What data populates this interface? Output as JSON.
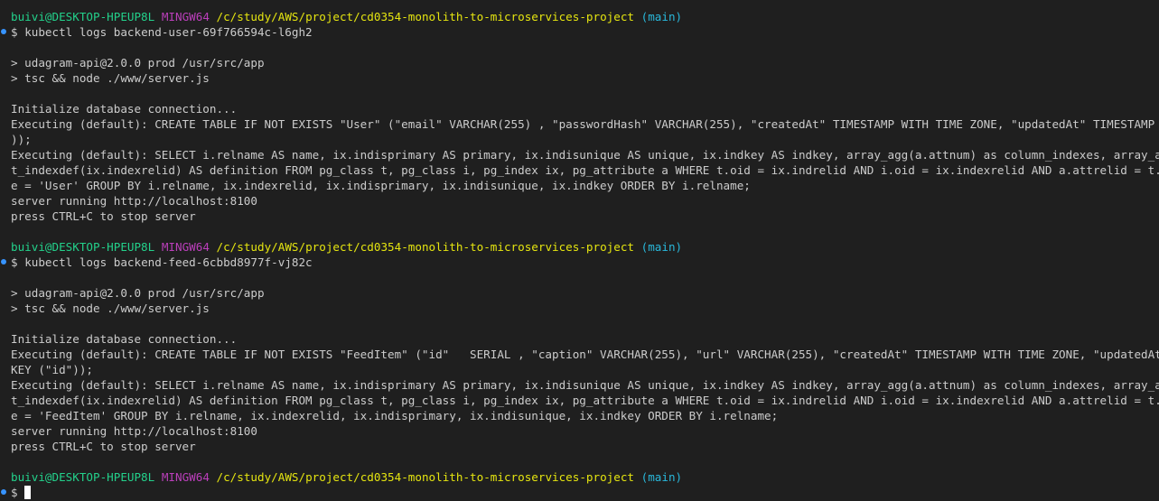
{
  "prompt": {
    "user_host": "buivi@DESKTOP-HPEUP8L",
    "shell": "MINGW64",
    "path": "/c/study/AWS/project/cd0354-monolith-to-microservices-project",
    "branch": "(main)",
    "symbol": "$"
  },
  "block1": {
    "command": "kubectl logs backend-user-69f766594c-l6gh2",
    "out1": "> udagram-api@2.0.0 prod /usr/src/app",
    "out2": "> tsc && node ./www/server.js",
    "out3": "Initialize database connection...",
    "out4": "Executing (default): CREATE TABLE IF NOT EXISTS \"User\" (\"email\" VARCHAR(255) , \"passwordHash\" VARCHAR(255), \"createdAt\" TIMESTAMP WITH TIME ZONE, \"updatedAt\" TIMESTAMP WITH TIME ZONE,",
    "out5": "));",
    "out6": "Executing (default): SELECT i.relname AS name, ix.indisprimary AS primary, ix.indisunique AS unique, ix.indkey AS indkey, array_agg(a.attnum) as column_indexes, array_agg(a.attname) as",
    "out7": "t_indexdef(ix.indexrelid) AS definition FROM pg_class t, pg_class i, pg_index ix, pg_attribute a WHERE t.oid = ix.indrelid AND i.oid = ix.indexrelid AND a.attrelid = t.oid AND t.relkind",
    "out8": "e = 'User' GROUP BY i.relname, ix.indexrelid, ix.indisprimary, ix.indisunique, ix.indkey ORDER BY i.relname;",
    "out9": "server running http://localhost:8100",
    "out10": "press CTRL+C to stop server"
  },
  "block2": {
    "command": "kubectl logs backend-feed-6cbbd8977f-vj82c",
    "out1": "> udagram-api@2.0.0 prod /usr/src/app",
    "out2": "> tsc && node ./www/server.js",
    "out3": "Initialize database connection...",
    "out4": "Executing (default): CREATE TABLE IF NOT EXISTS \"FeedItem\" (\"id\"   SERIAL , \"caption\" VARCHAR(255), \"url\" VARCHAR(255), \"createdAt\" TIMESTAMP WITH TIME ZONE, \"updatedAt\" TIMESTAMP WITH",
    "out5": "KEY (\"id\"));",
    "out6": "Executing (default): SELECT i.relname AS name, ix.indisprimary AS primary, ix.indisunique AS unique, ix.indkey AS indkey, array_agg(a.attnum) as column_indexes, array_agg(a.attname) as",
    "out7": "t_indexdef(ix.indexrelid) AS definition FROM pg_class t, pg_class i, pg_index ix, pg_attribute a WHERE t.oid = ix.indrelid AND i.oid = ix.indexrelid AND a.attrelid = t.oid AND t.relkind",
    "out8": "e = 'FeedItem' GROUP BY i.relname, ix.indexrelid, ix.indisprimary, ix.indisunique, ix.indkey ORDER BY i.relname;",
    "out9": "server running http://localhost:8100",
    "out10": "press CTRL+C to stop server"
  },
  "colors": {
    "background": "#1f1f1f",
    "text": "#cccccc",
    "user_host": "#23d18b",
    "shell": "#bc3fbc",
    "path": "#e5e510",
    "branch": "#29b8db",
    "decoration_dot": "#3794ff"
  }
}
